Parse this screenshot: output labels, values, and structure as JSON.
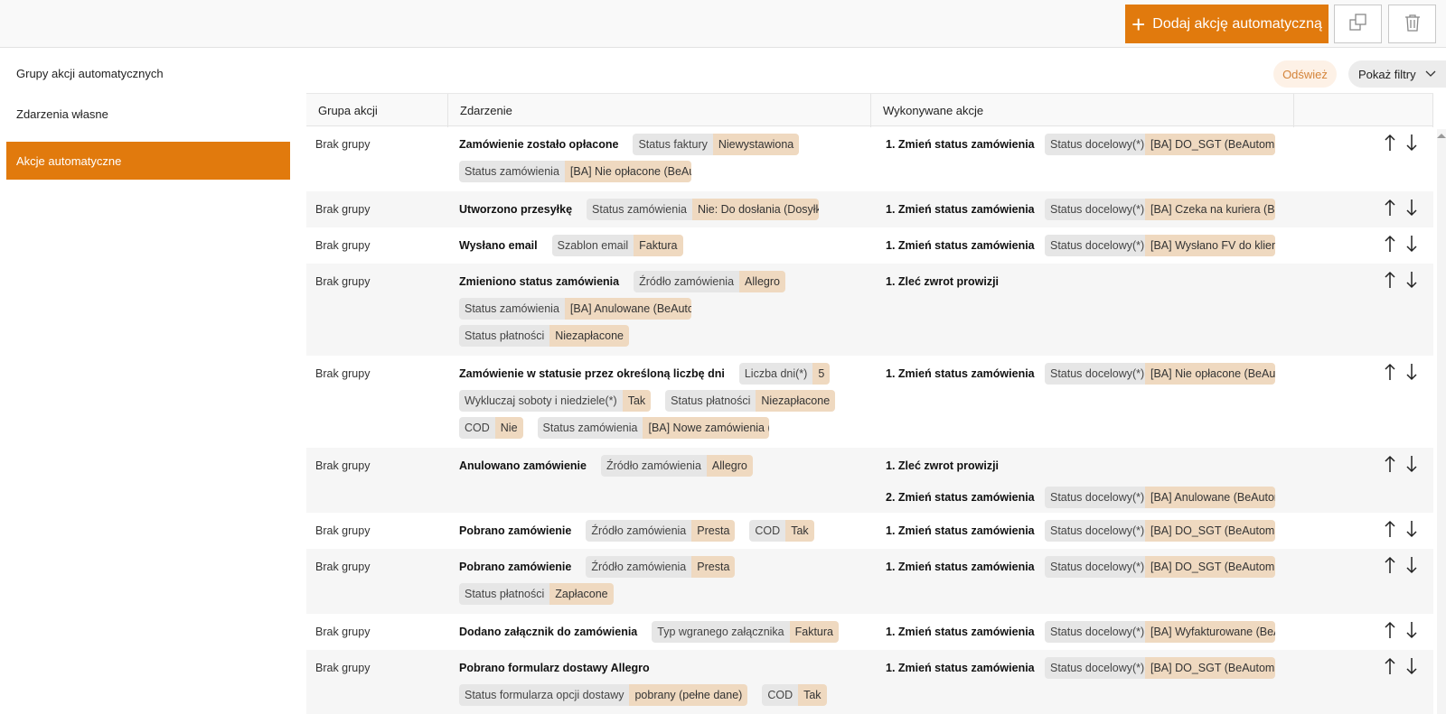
{
  "toolbar": {
    "add_label": "Dodaj akcję automatyczną",
    "add_icon": "plus-icon",
    "copy_icon": "copy-icon",
    "delete_icon": "trash-icon",
    "accent": "#e17a0d"
  },
  "sidebar": {
    "items": [
      {
        "label": "Grupy akcji automatycznych",
        "active": false
      },
      {
        "label": "Zdarzenia własne",
        "active": false
      },
      {
        "label": "Akcje automatyczne",
        "active": true
      }
    ]
  },
  "filters": {
    "refresh_label": "Odśwież",
    "show_filters_label": "Pokaż filtry",
    "chevron_icon": "chevron-down-icon"
  },
  "table": {
    "headers": [
      "Grupa akcji",
      "Zdarzenie",
      "Wykonywane akcje",
      ""
    ],
    "rows": [
      {
        "group": "Brak grupy",
        "event": "Zamówienie zostało opłacone",
        "conditions": [
          [
            {
              "k": "Status faktury",
              "v": "Niewystawiona"
            }
          ],
          [
            {
              "k": "Status zamówienia",
              "v": "[BA] Nie opłacone (BeAut"
            }
          ]
        ],
        "actions": [
          {
            "name": "1. Zmień status zamówienia",
            "k": "Status docelowy(*)",
            "v": "[BA] DO_SGT (BeAutoma"
          }
        ]
      },
      {
        "group": "Brak grupy",
        "event": "Utworzono przesyłkę",
        "conditions": [
          [
            {
              "k": "Status zamówienia",
              "v": "Nie: Do dosłania (Dosyłki"
            }
          ]
        ],
        "actions": [
          {
            "name": "1. Zmień status zamówienia",
            "k": "Status docelowy(*)",
            "v": "[BA] Czeka na kuriera (Be"
          }
        ]
      },
      {
        "group": "Brak grupy",
        "event": "Wysłano email",
        "conditions": [
          [
            {
              "k": "Szablon email",
              "v": "Faktura"
            }
          ]
        ],
        "actions": [
          {
            "name": "1. Zmień status zamówienia",
            "k": "Status docelowy(*)",
            "v": "[BA] Wysłano FV do klien"
          }
        ]
      },
      {
        "group": "Brak grupy",
        "event": "Zmieniono status zamówienia",
        "conditions": [
          [
            {
              "k": "Źródło zamówienia",
              "v": "Allegro"
            }
          ],
          [
            {
              "k": "Status zamówienia",
              "v": "[BA] Anulowane (BeAutor"
            }
          ],
          [
            {
              "k": "Status płatności",
              "v": "Niezapłacone"
            }
          ]
        ],
        "actions": [
          {
            "name": "1. Zleć zwrot prowizji",
            "k": "",
            "v": ""
          }
        ]
      },
      {
        "group": "Brak grupy",
        "event": "Zamówienie w statusie przez określoną liczbę dni",
        "conditions": [
          [
            {
              "k": "Liczba dni(*)",
              "v": "5"
            }
          ],
          [
            {
              "k": "Wykluczaj soboty i niedziele(*)",
              "v": "Tak"
            },
            {
              "k": "Status płatności",
              "v": "Niezapłacone"
            }
          ],
          [
            {
              "k": "COD",
              "v": "Nie"
            },
            {
              "k": "Status zamówienia",
              "v": "[BA] Nowe zamówienia (E"
            }
          ]
        ],
        "actions": [
          {
            "name": "1. Zmień status zamówienia",
            "k": "Status docelowy(*)",
            "v": "[BA] Nie opłacone (BeAut"
          }
        ]
      },
      {
        "group": "Brak grupy",
        "event": "Anulowano zamówienie",
        "conditions": [
          [
            {
              "k": "Źródło zamówienia",
              "v": "Allegro"
            }
          ]
        ],
        "actions": [
          {
            "name": "1. Zleć zwrot prowizji",
            "k": "",
            "v": ""
          },
          {
            "name": "2. Zmień status zamówienia",
            "k": "Status docelowy(*)",
            "v": "[BA] Anulowane (BeAutor"
          }
        ]
      },
      {
        "group": "Brak grupy",
        "event": "Pobrano zamówienie",
        "conditions": [
          [
            {
              "k": "Źródło zamówienia",
              "v": "Presta"
            },
            {
              "k": "COD",
              "v": "Tak"
            }
          ]
        ],
        "actions": [
          {
            "name": "1. Zmień status zamówienia",
            "k": "Status docelowy(*)",
            "v": "[BA] DO_SGT (BeAutoma"
          }
        ]
      },
      {
        "group": "Brak grupy",
        "event": "Pobrano zamówienie",
        "conditions": [
          [
            {
              "k": "Źródło zamówienia",
              "v": "Presta"
            }
          ],
          [
            {
              "k": "Status płatności",
              "v": "Zapłacone"
            }
          ]
        ],
        "actions": [
          {
            "name": "1. Zmień status zamówienia",
            "k": "Status docelowy(*)",
            "v": "[BA] DO_SGT (BeAutoma"
          }
        ]
      },
      {
        "group": "Brak grupy",
        "event": "Dodano załącznik do zamówienia",
        "conditions": [
          [
            {
              "k": "Typ wgranego załącznika",
              "v": "Faktura"
            }
          ]
        ],
        "actions": [
          {
            "name": "1. Zmień status zamówienia",
            "k": "Status docelowy(*)",
            "v": "[BA] Wyfakturowane (BeA"
          }
        ]
      },
      {
        "group": "Brak grupy",
        "event": "Pobrano formularz dostawy Allegro",
        "conditions": [
          [],
          [
            {
              "k": "Status formularza opcji dostawy",
              "v": "pobrany (pełne dane)"
            },
            {
              "k": "COD",
              "v": "Tak"
            }
          ]
        ],
        "actions": [
          {
            "name": "1. Zmień status zamówienia",
            "k": "Status docelowy(*)",
            "v": "[BA] DO_SGT (BeAutoma"
          }
        ]
      }
    ]
  }
}
